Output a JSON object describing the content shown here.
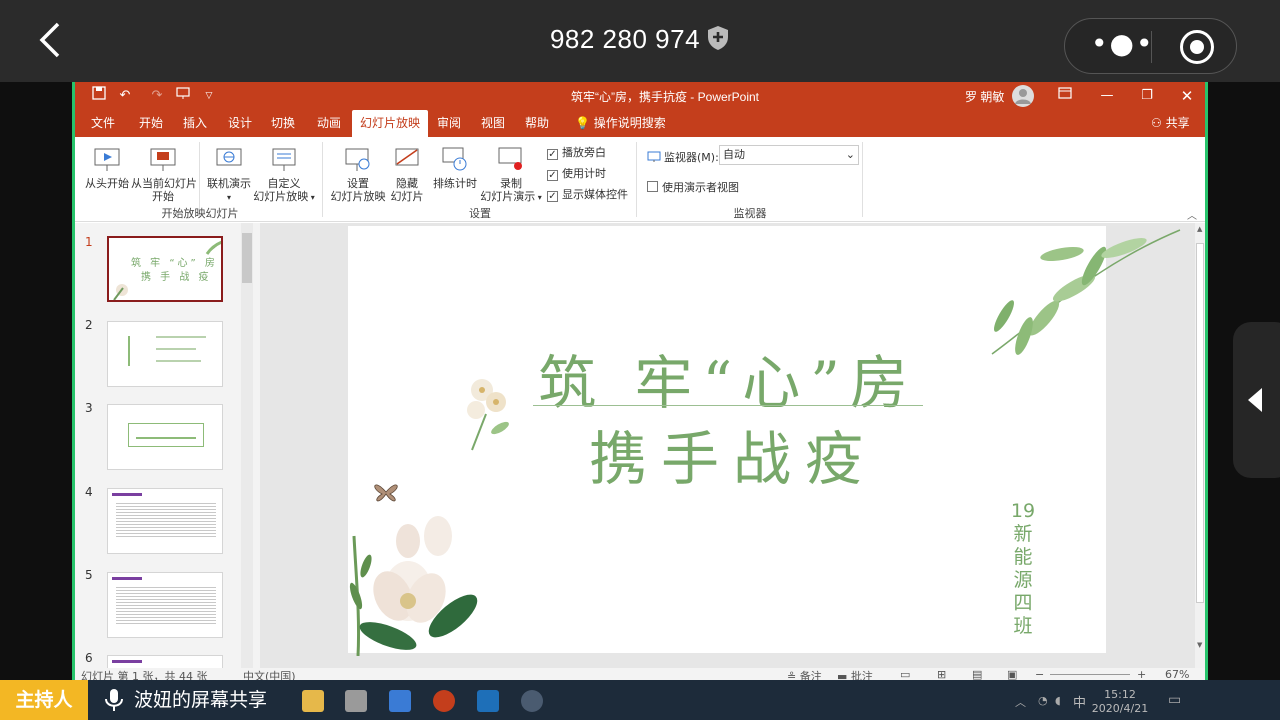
{
  "meeting": {
    "id": "982 280 974",
    "host_badge": "主持人",
    "share_label": "波妞的屏幕共享"
  },
  "ppt": {
    "window_title": "筑牢“心”房，携手抗疫  -  PowerPoint",
    "user_name": "罗 朝敏",
    "share_button": "共享",
    "menu": [
      "文件",
      "开始",
      "插入",
      "设计",
      "切换",
      "动画",
      "幻灯片放映",
      "审阅",
      "视图",
      "帮助"
    ],
    "active_menu": "幻灯片放映",
    "tell_me": "操作说明搜索",
    "ribbon": {
      "from_beginning": "从头开始",
      "from_current_1": "从当前幻灯片",
      "from_current_2": "开始",
      "online_present": "联机演示",
      "custom_1": "自定义",
      "custom_2": "幻灯片放映",
      "group_start": "开始放映幻灯片",
      "setup_1": "设置",
      "setup_2": "幻灯片放映",
      "hide_1": "隐藏",
      "hide_2": "幻灯片",
      "rehearse": "排练计时",
      "record_1": "录制",
      "record_2": "幻灯片演示",
      "play_narrations": "播放旁白",
      "use_timings": "使用计时",
      "show_media_controls": "显示媒体控件",
      "group_setup": "设置",
      "monitor_label": "监视器(M):",
      "monitor_value": "自动",
      "presenter_view": "使用演示者视图",
      "group_monitor": "监视器"
    },
    "slide_numbers": [
      "1",
      "2",
      "3",
      "4",
      "5",
      "6"
    ],
    "slide": {
      "title_line1": "筑 牢“心”房",
      "title_line2": "携手战疫",
      "class_label": "19\n新\n能\n源\n四\n班"
    },
    "status": {
      "slide_info": "幻灯片 第 1 张，共 44 张",
      "language": "中文(中国)",
      "notes": "备注",
      "comments": "批注",
      "zoom": "67%"
    },
    "taskbar": {
      "time": "15:12",
      "date": "2020/4/21",
      "ime": "中"
    }
  },
  "colors": {
    "ppt_red": "#c43e1c",
    "slide_green": "#78a86a",
    "host_yellow": "#f3b724",
    "share_border": "#27c46b"
  }
}
